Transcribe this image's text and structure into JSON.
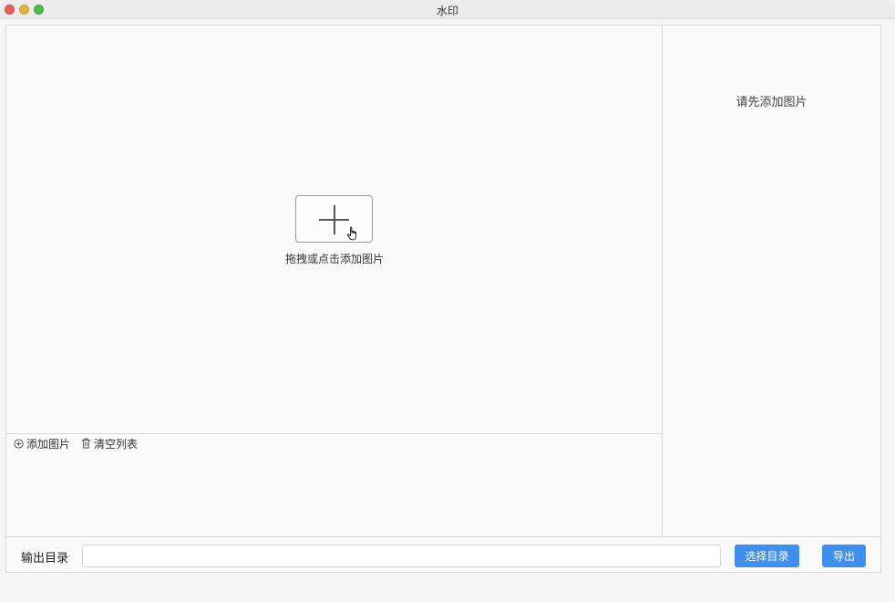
{
  "window": {
    "title": "水印"
  },
  "dropzone": {
    "hint": "拖拽或点击添加图片"
  },
  "list_toolbar": {
    "add_label": "添加图片",
    "clear_label": "清空列表"
  },
  "preview": {
    "empty_hint": "请先添加图片"
  },
  "output": {
    "label": "输出目录",
    "path_value": "",
    "select_button": "选择目录",
    "export_button": "导出"
  },
  "colors": {
    "primary": "#3d8ff0",
    "close": "#ec5f57",
    "minimize": "#e3b437",
    "maximize": "#4cc049"
  },
  "icons": {
    "add": "plus-circle-icon",
    "clear": "trash-icon",
    "drop": "plus-icon",
    "pointer": "hand-pointer-icon"
  }
}
